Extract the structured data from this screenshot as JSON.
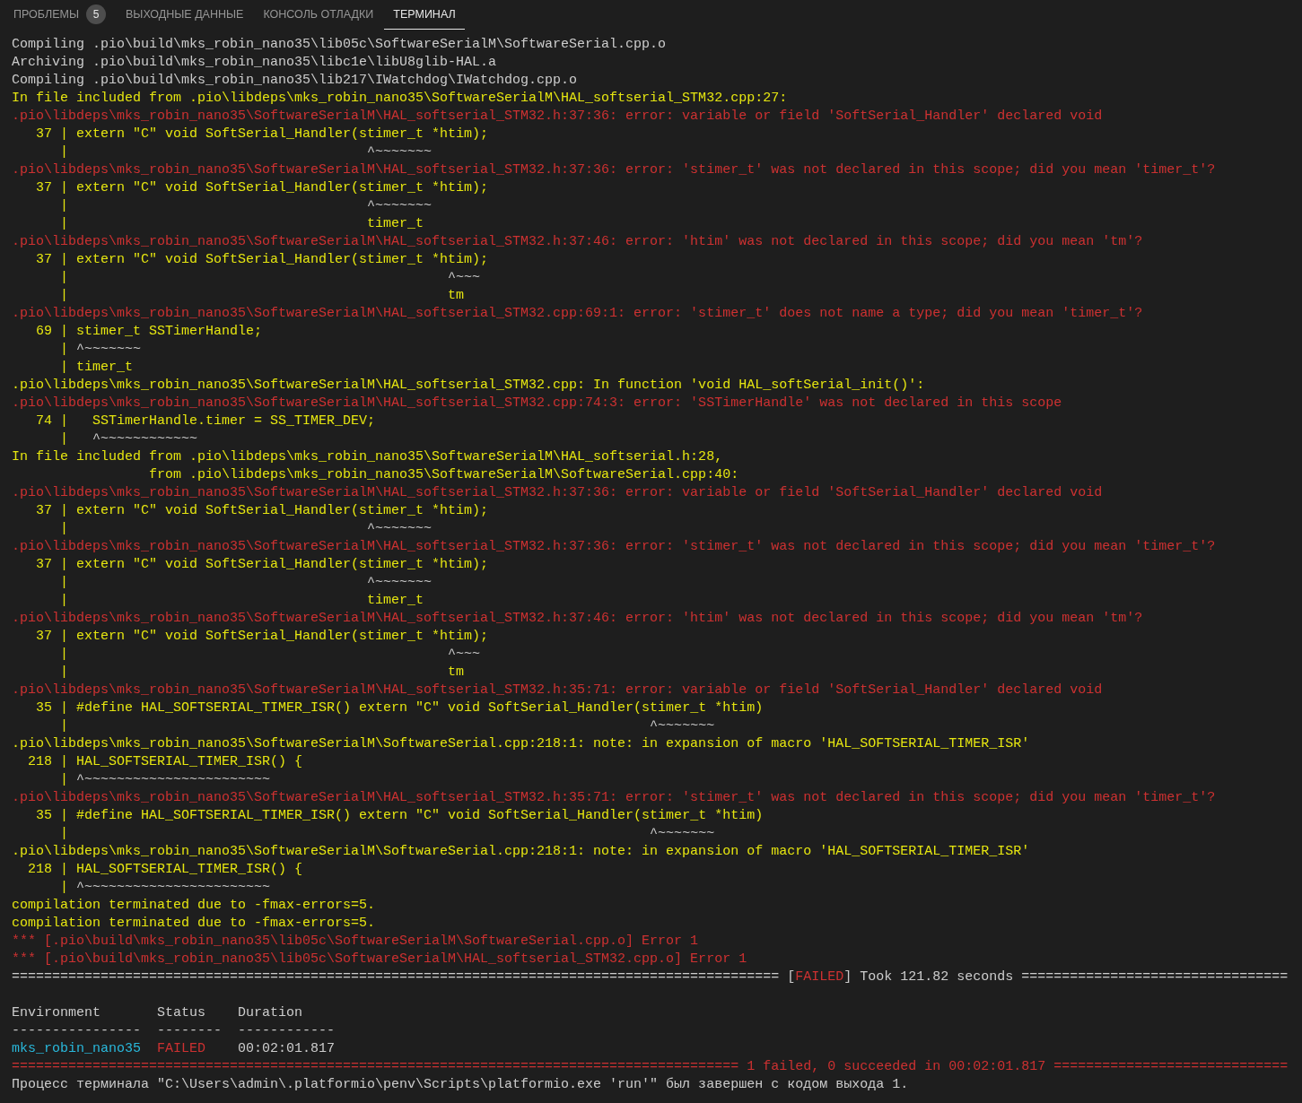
{
  "tabs": [
    {
      "label": "ПРОБЛЕМЫ",
      "badge": "5",
      "selected": false
    },
    {
      "label": "ВЫХОДНЫЕ ДАННЫЕ",
      "selected": false
    },
    {
      "label": "КОНСОЛЬ ОТЛАДКИ",
      "selected": false
    },
    {
      "label": "ТЕРМИНАЛ",
      "selected": true
    }
  ],
  "terminal": {
    "lines": [
      {
        "kind": "text",
        "segments": [
          {
            "kind": "plain",
            "text": "Compiling .pio\\build\\mks_robin_nano35\\lib05c\\SoftwareSerialM\\SoftwareSerial.cpp.o"
          }
        ]
      },
      {
        "kind": "text",
        "segments": [
          {
            "kind": "plain",
            "text": "Archiving .pio\\build\\mks_robin_nano35\\libc1e\\libU8glib-HAL.a"
          }
        ]
      },
      {
        "kind": "text",
        "segments": [
          {
            "kind": "plain",
            "text": "Compiling .pio\\build\\mks_robin_nano35\\lib217\\IWatchdog\\IWatchdog.cpp.o"
          }
        ]
      },
      {
        "kind": "text",
        "segments": [
          {
            "kind": "warn",
            "text": "In file included from .pio\\libdeps\\mks_robin_nano35\\SoftwareSerialM\\HAL_softserial_STM32.cpp:27:"
          }
        ]
      },
      {
        "kind": "text",
        "segments": [
          {
            "kind": "error",
            "text": ".pio\\libdeps\\mks_robin_nano35\\SoftwareSerialM\\HAL_softserial_STM32.h:37:36: error: variable or field 'SoftSerial_Handler' declared void"
          }
        ]
      },
      {
        "kind": "text",
        "segments": [
          {
            "kind": "gutter",
            "text": "   37 | "
          },
          {
            "kind": "warn",
            "text": "extern \"C\" void SoftSerial_Handler(stimer_t *htim);"
          }
        ]
      },
      {
        "kind": "text",
        "segments": [
          {
            "kind": "gutter",
            "text": "      | "
          },
          {
            "kind": "caret",
            "text": "                                    ^~~~~~~~"
          }
        ]
      },
      {
        "kind": "text",
        "segments": [
          {
            "kind": "error",
            "text": ".pio\\libdeps\\mks_robin_nano35\\SoftwareSerialM\\HAL_softserial_STM32.h:37:36: error: 'stimer_t' was not declared in this scope; did you mean 'timer_t'?"
          }
        ]
      },
      {
        "kind": "text",
        "segments": [
          {
            "kind": "gutter",
            "text": "   37 | "
          },
          {
            "kind": "warn",
            "text": "extern \"C\" void SoftSerial_Handler(stimer_t *htim);"
          }
        ]
      },
      {
        "kind": "text",
        "segments": [
          {
            "kind": "gutter",
            "text": "      | "
          },
          {
            "kind": "caret",
            "text": "                                    ^~~~~~~~"
          }
        ]
      },
      {
        "kind": "text",
        "segments": [
          {
            "kind": "gutter",
            "text": "      | "
          },
          {
            "kind": "warn",
            "text": "                                    timer_t"
          }
        ]
      },
      {
        "kind": "text",
        "segments": [
          {
            "kind": "error",
            "text": ".pio\\libdeps\\mks_robin_nano35\\SoftwareSerialM\\HAL_softserial_STM32.h:37:46: error: 'htim' was not declared in this scope; did you mean 'tm'?"
          }
        ]
      },
      {
        "kind": "text",
        "segments": [
          {
            "kind": "gutter",
            "text": "   37 | "
          },
          {
            "kind": "warn",
            "text": "extern \"C\" void SoftSerial_Handler(stimer_t *htim);"
          }
        ]
      },
      {
        "kind": "text",
        "segments": [
          {
            "kind": "gutter",
            "text": "      | "
          },
          {
            "kind": "caret",
            "text": "                                              ^~~~"
          }
        ]
      },
      {
        "kind": "text",
        "segments": [
          {
            "kind": "gutter",
            "text": "      | "
          },
          {
            "kind": "warn",
            "text": "                                              tm"
          }
        ]
      },
      {
        "kind": "text",
        "segments": [
          {
            "kind": "error",
            "text": ".pio\\libdeps\\mks_robin_nano35\\SoftwareSerialM\\HAL_softserial_STM32.cpp:69:1: error: 'stimer_t' does not name a type; did you mean 'timer_t'?"
          }
        ]
      },
      {
        "kind": "text",
        "segments": [
          {
            "kind": "gutter",
            "text": "   69 | "
          },
          {
            "kind": "warn",
            "text": "stimer_t SSTimerHandle;"
          }
        ]
      },
      {
        "kind": "text",
        "segments": [
          {
            "kind": "gutter",
            "text": "      | "
          },
          {
            "kind": "caret",
            "text": "^~~~~~~~"
          }
        ]
      },
      {
        "kind": "text",
        "segments": [
          {
            "kind": "gutter",
            "text": "      | "
          },
          {
            "kind": "warn",
            "text": "timer_t"
          }
        ]
      },
      {
        "kind": "text",
        "segments": [
          {
            "kind": "warn",
            "text": ".pio\\libdeps\\mks_robin_nano35\\SoftwareSerialM\\HAL_softserial_STM32.cpp: In function 'void HAL_softSerial_init()':"
          }
        ]
      },
      {
        "kind": "text",
        "segments": [
          {
            "kind": "error",
            "text": ".pio\\libdeps\\mks_robin_nano35\\SoftwareSerialM\\HAL_softserial_STM32.cpp:74:3: error: 'SSTimerHandle' was not declared in this scope"
          }
        ]
      },
      {
        "kind": "text",
        "segments": [
          {
            "kind": "gutter",
            "text": "   74 | "
          },
          {
            "kind": "warn",
            "text": "  SSTimerHandle.timer = SS_TIMER_DEV;"
          }
        ]
      },
      {
        "kind": "text",
        "segments": [
          {
            "kind": "gutter",
            "text": "      | "
          },
          {
            "kind": "caret",
            "text": "  ^~~~~~~~~~~~~"
          }
        ]
      },
      {
        "kind": "text",
        "segments": [
          {
            "kind": "warn",
            "text": "In file included from .pio\\libdeps\\mks_robin_nano35\\SoftwareSerialM\\HAL_softserial.h:28,"
          }
        ]
      },
      {
        "kind": "text",
        "segments": [
          {
            "kind": "warn",
            "text": "                 from .pio\\libdeps\\mks_robin_nano35\\SoftwareSerialM\\SoftwareSerial.cpp:40:"
          }
        ]
      },
      {
        "kind": "text",
        "segments": [
          {
            "kind": "error",
            "text": ".pio\\libdeps\\mks_robin_nano35\\SoftwareSerialM\\HAL_softserial_STM32.h:37:36: error: variable or field 'SoftSerial_Handler' declared void"
          }
        ]
      },
      {
        "kind": "text",
        "segments": [
          {
            "kind": "gutter",
            "text": "   37 | "
          },
          {
            "kind": "warn",
            "text": "extern \"C\" void SoftSerial_Handler(stimer_t *htim);"
          }
        ]
      },
      {
        "kind": "text",
        "segments": [
          {
            "kind": "gutter",
            "text": "      | "
          },
          {
            "kind": "caret",
            "text": "                                    ^~~~~~~~"
          }
        ]
      },
      {
        "kind": "text",
        "segments": [
          {
            "kind": "error",
            "text": ".pio\\libdeps\\mks_robin_nano35\\SoftwareSerialM\\HAL_softserial_STM32.h:37:36: error: 'stimer_t' was not declared in this scope; did you mean 'timer_t'?"
          }
        ]
      },
      {
        "kind": "text",
        "segments": [
          {
            "kind": "gutter",
            "text": "   37 | "
          },
          {
            "kind": "warn",
            "text": "extern \"C\" void SoftSerial_Handler(stimer_t *htim);"
          }
        ]
      },
      {
        "kind": "text",
        "segments": [
          {
            "kind": "gutter",
            "text": "      | "
          },
          {
            "kind": "caret",
            "text": "                                    ^~~~~~~~"
          }
        ]
      },
      {
        "kind": "text",
        "segments": [
          {
            "kind": "gutter",
            "text": "      | "
          },
          {
            "kind": "warn",
            "text": "                                    timer_t"
          }
        ]
      },
      {
        "kind": "text",
        "segments": [
          {
            "kind": "error",
            "text": ".pio\\libdeps\\mks_robin_nano35\\SoftwareSerialM\\HAL_softserial_STM32.h:37:46: error: 'htim' was not declared in this scope; did you mean 'tm'?"
          }
        ]
      },
      {
        "kind": "text",
        "segments": [
          {
            "kind": "gutter",
            "text": "   37 | "
          },
          {
            "kind": "warn",
            "text": "extern \"C\" void SoftSerial_Handler(stimer_t *htim);"
          }
        ]
      },
      {
        "kind": "text",
        "segments": [
          {
            "kind": "gutter",
            "text": "      | "
          },
          {
            "kind": "caret",
            "text": "                                              ^~~~"
          }
        ]
      },
      {
        "kind": "text",
        "segments": [
          {
            "kind": "gutter",
            "text": "      | "
          },
          {
            "kind": "warn",
            "text": "                                              tm"
          }
        ]
      },
      {
        "kind": "text",
        "segments": [
          {
            "kind": "error",
            "text": ".pio\\libdeps\\mks_robin_nano35\\SoftwareSerialM\\HAL_softserial_STM32.h:35:71: error: variable or field 'SoftSerial_Handler' declared void"
          }
        ]
      },
      {
        "kind": "text",
        "segments": [
          {
            "kind": "gutter",
            "text": "   35 | "
          },
          {
            "kind": "warn",
            "text": "#define HAL_SOFTSERIAL_TIMER_ISR() extern \"C\" void SoftSerial_Handler(stimer_t *htim)"
          }
        ]
      },
      {
        "kind": "text",
        "segments": [
          {
            "kind": "gutter",
            "text": "      | "
          },
          {
            "kind": "caret",
            "text": "                                                                       ^~~~~~~~"
          }
        ]
      },
      {
        "kind": "text",
        "segments": [
          {
            "kind": "warn",
            "text": ".pio\\libdeps\\mks_robin_nano35\\SoftwareSerialM\\SoftwareSerial.cpp:218:1: note: in expansion of macro 'HAL_SOFTSERIAL_TIMER_ISR'"
          }
        ]
      },
      {
        "kind": "text",
        "segments": [
          {
            "kind": "gutter",
            "text": "  218 | "
          },
          {
            "kind": "warn",
            "text": "HAL_SOFTSERIAL_TIMER_ISR() {"
          }
        ]
      },
      {
        "kind": "text",
        "segments": [
          {
            "kind": "gutter",
            "text": "      | "
          },
          {
            "kind": "caret",
            "text": "^~~~~~~~~~~~~~~~~~~~~~~~"
          }
        ]
      },
      {
        "kind": "text",
        "segments": [
          {
            "kind": "error",
            "text": ".pio\\libdeps\\mks_robin_nano35\\SoftwareSerialM\\HAL_softserial_STM32.h:35:71: error: 'stimer_t' was not declared in this scope; did you mean 'timer_t'?"
          }
        ]
      },
      {
        "kind": "text",
        "segments": [
          {
            "kind": "gutter",
            "text": "   35 | "
          },
          {
            "kind": "warn",
            "text": "#define HAL_SOFTSERIAL_TIMER_ISR() extern \"C\" void SoftSerial_Handler(stimer_t *htim)"
          }
        ]
      },
      {
        "kind": "text",
        "segments": [
          {
            "kind": "gutter",
            "text": "      | "
          },
          {
            "kind": "caret",
            "text": "                                                                       ^~~~~~~~"
          }
        ]
      },
      {
        "kind": "text",
        "segments": [
          {
            "kind": "warn",
            "text": ".pio\\libdeps\\mks_robin_nano35\\SoftwareSerialM\\SoftwareSerial.cpp:218:1: note: in expansion of macro 'HAL_SOFTSERIAL_TIMER_ISR'"
          }
        ]
      },
      {
        "kind": "text",
        "segments": [
          {
            "kind": "gutter",
            "text": "  218 | "
          },
          {
            "kind": "warn",
            "text": "HAL_SOFTSERIAL_TIMER_ISR() {"
          }
        ]
      },
      {
        "kind": "text",
        "segments": [
          {
            "kind": "gutter",
            "text": "      | "
          },
          {
            "kind": "caret",
            "text": "^~~~~~~~~~~~~~~~~~~~~~~~"
          }
        ]
      },
      {
        "kind": "text",
        "segments": [
          {
            "kind": "warn",
            "text": "compilation terminated due to -fmax-errors=5."
          }
        ]
      },
      {
        "kind": "text",
        "segments": [
          {
            "kind": "warn",
            "text": "compilation terminated due to -fmax-errors=5."
          }
        ]
      },
      {
        "kind": "text",
        "segments": [
          {
            "kind": "error",
            "text": "*** [.pio\\build\\mks_robin_nano35\\lib05c\\SoftwareSerialM\\SoftwareSerial.cpp.o] Error 1"
          }
        ]
      },
      {
        "kind": "text",
        "segments": [
          {
            "kind": "error",
            "text": "*** [.pio\\build\\mks_robin_nano35\\lib05c\\SoftwareSerialM\\HAL_softserial_STM32.cpp.o] Error 1"
          }
        ]
      },
      {
        "kind": "text",
        "segments": [
          {
            "kind": "plain",
            "text": "=============================================================================================== ["
          },
          {
            "kind": "error",
            "text": "FAILED"
          },
          {
            "kind": "plain",
            "text": "] Took 121.82 seconds ================================="
          }
        ]
      },
      {
        "kind": "blank"
      },
      {
        "kind": "text",
        "segments": [
          {
            "kind": "plain",
            "text": "Environment       Status    Duration"
          }
        ]
      },
      {
        "kind": "text",
        "segments": [
          {
            "kind": "plain",
            "text": "----------------  --------  ------------"
          }
        ]
      },
      {
        "kind": "text",
        "segments": [
          {
            "kind": "link",
            "text": "mks_robin_nano35"
          },
          {
            "kind": "error",
            "text": "  FAILED"
          },
          {
            "kind": "plain",
            "text": "    00:02:01.817"
          }
        ]
      },
      {
        "kind": "text",
        "segments": [
          {
            "kind": "error",
            "text": "========================================================================================== 1 failed, 0 succeeded in 00:02:01.817 ============================="
          }
        ]
      },
      {
        "kind": "text",
        "segments": [
          {
            "kind": "plain",
            "text": "Процесс терминала \"C:\\Users\\admin\\.platformio\\penv\\Scripts\\platformio.exe 'run'\" был завершен с кодом выхода 1."
          }
        ]
      }
    ]
  }
}
